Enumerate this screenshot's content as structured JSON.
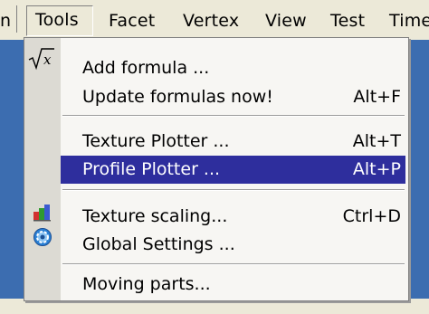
{
  "menubar": {
    "items": [
      {
        "label": "n"
      },
      {
        "label": "Tools"
      },
      {
        "label": "Facet"
      },
      {
        "label": "Vertex"
      },
      {
        "label": "View"
      },
      {
        "label": "Test"
      },
      {
        "label": "Time"
      }
    ]
  },
  "tools_menu": {
    "add_formula": {
      "label": "Add formula ..."
    },
    "update_formulas": {
      "label": "Update formulas now!",
      "shortcut": "Alt+F"
    },
    "texture_plotter": {
      "label": "Texture Plotter ...",
      "shortcut": "Alt+T"
    },
    "profile_plotter": {
      "label": "Profile Plotter ...",
      "shortcut": "Alt+P"
    },
    "texture_scaling": {
      "label": "Texture scaling...",
      "shortcut": "Ctrl+D"
    },
    "global_settings": {
      "label": "Global Settings ..."
    },
    "moving_parts": {
      "label": "Moving parts..."
    }
  },
  "icons": {
    "formula": "sqrt-x-icon",
    "texture_scaling": "bar-chart-icon",
    "global_settings": "gear-icon"
  },
  "colors": {
    "highlight": "#2e2e9d",
    "backdrop": "#3c6db0",
    "menu_background": "#f7f6f3"
  }
}
